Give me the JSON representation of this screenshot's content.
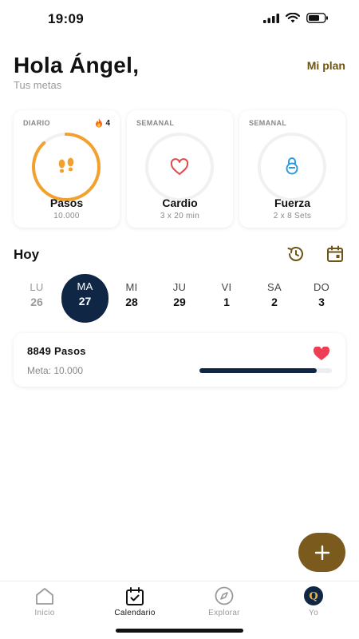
{
  "status_bar": {
    "time": "19:09"
  },
  "header": {
    "greeting": "Hola Ángel,",
    "subtitle": "Tus metas",
    "plan_link": "Mi plan"
  },
  "goals": [
    {
      "frequency": "DIARIO",
      "streak": "4",
      "name": "Pasos",
      "detail": "10.000",
      "icon": "footsteps-icon",
      "color": "#f2a12e",
      "progress": 0.88
    },
    {
      "frequency": "SEMANAL",
      "name": "Cardio",
      "detail": "3 x 20 min",
      "icon": "heart-icon",
      "color": "#e14a4a",
      "progress": 0
    },
    {
      "frequency": "SEMANAL",
      "name": "Fuerza",
      "detail": "2 x 8 Sets",
      "icon": "kettlebell-icon",
      "color": "#2d9be0",
      "progress": 0
    }
  ],
  "today": {
    "title": "Hoy",
    "days": [
      {
        "name": "LU",
        "num": "26"
      },
      {
        "name": "MA",
        "num": "27"
      },
      {
        "name": "MI",
        "num": "28"
      },
      {
        "name": "JU",
        "num": "29"
      },
      {
        "name": "VI",
        "num": "1"
      },
      {
        "name": "SA",
        "num": "2"
      },
      {
        "name": "DO",
        "num": "3"
      }
    ],
    "selected_day": "27"
  },
  "steps_card": {
    "title": "8849 Pasos",
    "goal": "Meta: 10.000",
    "progress": 0.885
  },
  "tabs": [
    {
      "label": "Inicio",
      "icon": "home-icon"
    },
    {
      "label": "Calendario",
      "icon": "calendar-icon"
    },
    {
      "label": "Explorar",
      "icon": "compass-icon"
    },
    {
      "label": "Yo",
      "icon": "avatar-icon",
      "avatar_letter": "Q"
    }
  ],
  "active_tab": "Calendario",
  "colors": {
    "accent": "#7b5a1d",
    "navy": "#0f2644",
    "steps_orange": "#f2a12e",
    "heart_red": "#e14a4a",
    "strength_blue": "#2d9be0"
  }
}
